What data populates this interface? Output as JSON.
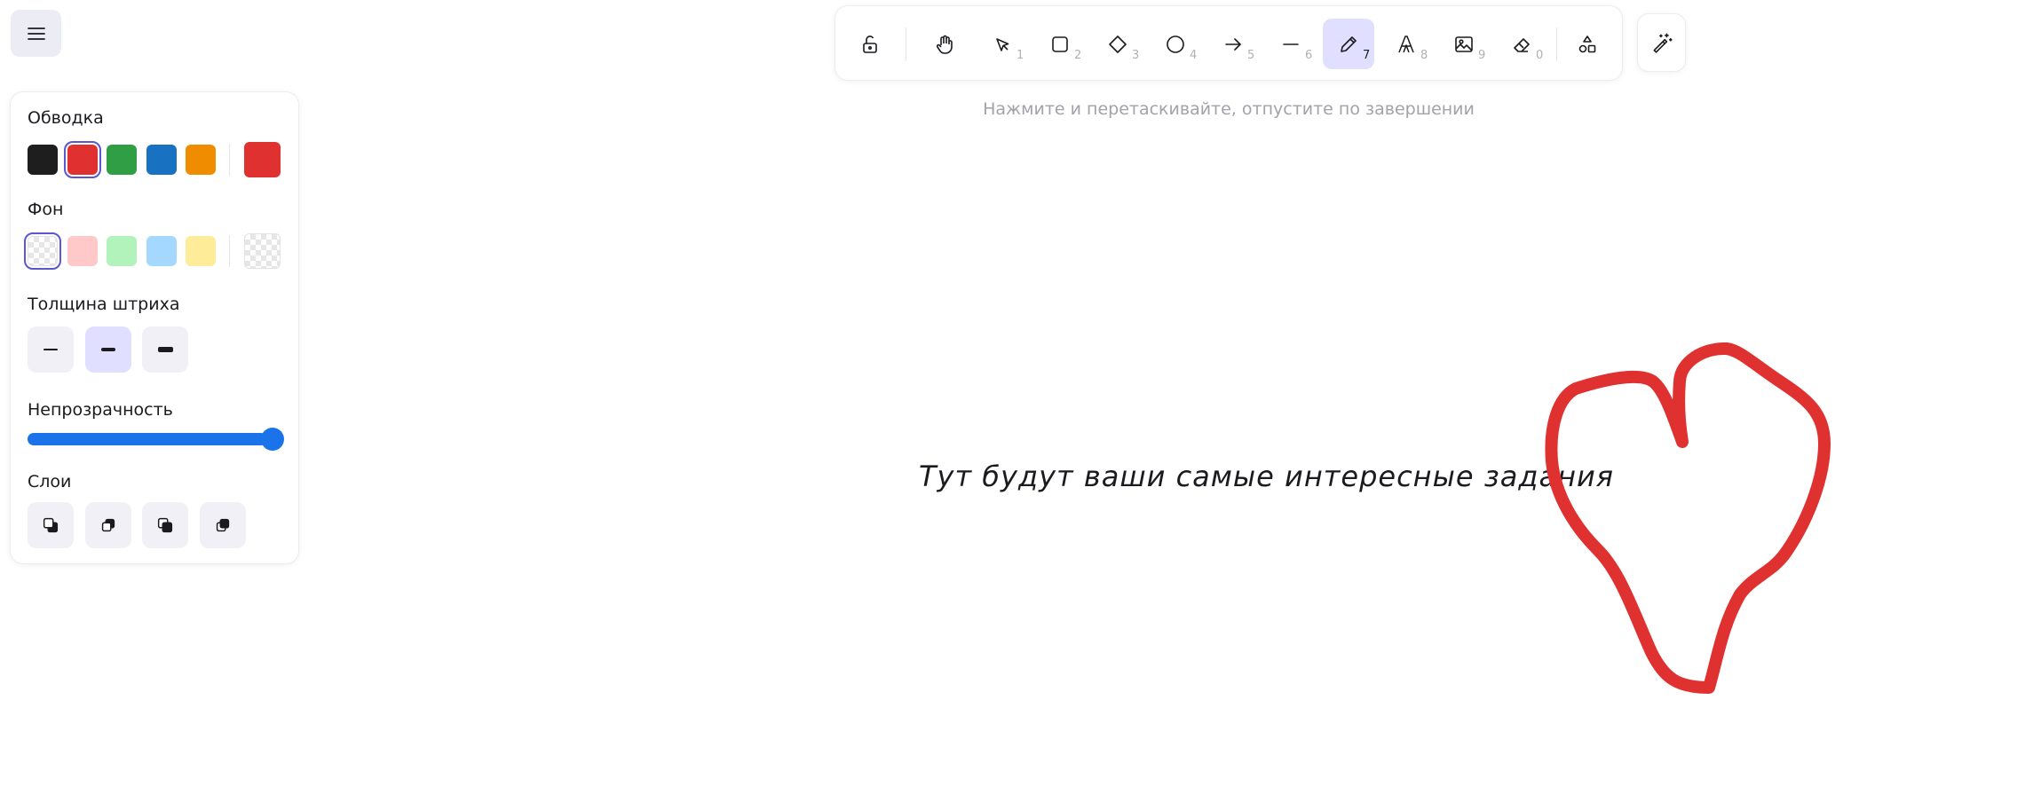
{
  "menu": {
    "icon": "hamburger-icon"
  },
  "toolbar": {
    "tools": [
      {
        "name": "lock",
        "icon": "lock-open-icon",
        "key": ""
      },
      {
        "name": "hand",
        "icon": "hand-icon",
        "key": ""
      },
      {
        "name": "selection",
        "icon": "pointer-icon",
        "key": "1"
      },
      {
        "name": "rectangle",
        "icon": "square-icon",
        "key": "2"
      },
      {
        "name": "diamond",
        "icon": "diamond-icon",
        "key": "3"
      },
      {
        "name": "ellipse",
        "icon": "circle-icon",
        "key": "4"
      },
      {
        "name": "arrow",
        "icon": "arrow-right-icon",
        "key": "5"
      },
      {
        "name": "line",
        "icon": "line-icon",
        "key": "6"
      },
      {
        "name": "pencil",
        "icon": "pencil-icon",
        "key": "7",
        "active": true
      },
      {
        "name": "text",
        "icon": "text-icon",
        "key": "8"
      },
      {
        "name": "image",
        "icon": "image-icon",
        "key": "9"
      },
      {
        "name": "eraser",
        "icon": "eraser-icon",
        "key": "0"
      },
      {
        "name": "more-shapes",
        "icon": "shapes-icon",
        "key": ""
      }
    ],
    "extra_icon": "magic-wand-icon"
  },
  "hint": "Нажмите и перетаскивайте, отпустите по завершении",
  "panel": {
    "stroke": {
      "label": "Обводка",
      "colors": [
        "#1e1e1e",
        "#e03131",
        "#2f9e44",
        "#1971c2",
        "#f08c00"
      ],
      "selected": "#e03131"
    },
    "background": {
      "label": "Фон",
      "colors": [
        "transparent",
        "#ffc9c9",
        "#b2f2bb",
        "#a5d8ff",
        "#ffec99"
      ],
      "selected": "transparent"
    },
    "stroke_width": {
      "label": "Толщина штриха",
      "options": [
        "thin",
        "bold",
        "extra-bold"
      ],
      "selected": "bold"
    },
    "opacity": {
      "label": "Непрозрачность",
      "value": 100
    },
    "layers": {
      "label": "Слои",
      "icons": [
        "send-to-back-icon",
        "send-backward-icon",
        "bring-forward-icon",
        "bring-to-front-icon"
      ]
    }
  },
  "canvas": {
    "text": "Тут будут ваши самые интересные задания",
    "heart_color": "#e03131"
  }
}
